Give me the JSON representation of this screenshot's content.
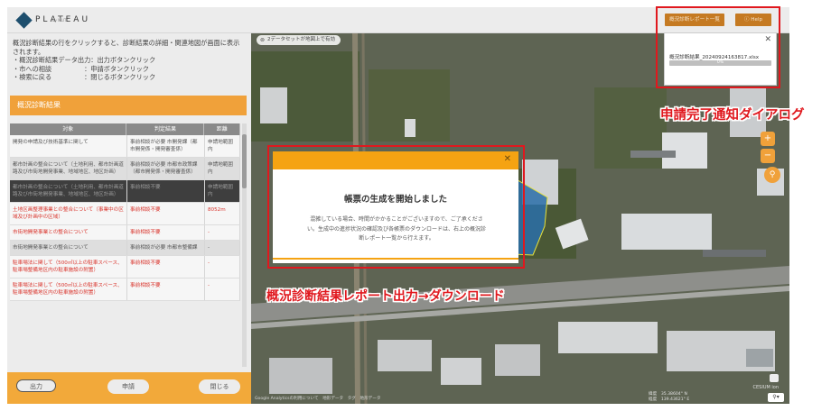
{
  "app": {
    "logo_text": "PLATEAU",
    "logo_sub": "by MLIT"
  },
  "panel": {
    "instructions": [
      "概況診断結果の行をクリックすると、診断結果の詳細・関連地図が画面に表示",
      "されます。",
      "・概況診断結果データ出力：出力ボタンクリック",
      "・市への相談　　　　　：申請ボタンクリック",
      "・検索に戻る　　　　　：閉じるボタンクリック"
    ],
    "section_title": "概況診断結果",
    "table": {
      "headers": [
        "対象",
        "判定結果",
        "距離"
      ],
      "rows": [
        {
          "style": "light",
          "cells": [
            "開発の申請及び技術基準に関して",
            "事前相談が必要 市開発課（都市開発係・開発審査係）",
            "申請地範囲内"
          ]
        },
        {
          "style": "mid",
          "cells": [
            "都市計画の整合について（土地利用、都市計画道路及び市街地開発事業、地域地区、地区計画）",
            "事前相談が必要 市都市政策課（都市開発係・開発審査係）",
            "申請地範囲内"
          ]
        },
        {
          "style": "dark",
          "cells": [
            "都市計画の整合について（土地利用、都市計画道路及び市街地開発事業、地域地区、地区計画）",
            "事前相談不要",
            "申請地範囲内"
          ]
        },
        {
          "style": "red",
          "cells": [
            "土地区画整理事業との整合について（事業中の区域及び計画中の区域）",
            "事前相談不要",
            "8052m"
          ]
        },
        {
          "style": "red",
          "cells": [
            "市街地開発事業との整合について",
            "事前相談不要",
            "-"
          ]
        },
        {
          "style": "mid",
          "cells": [
            "市街地開発事業との整合について",
            "事前相談が必要 市都市整備課",
            "-"
          ]
        },
        {
          "style": "red",
          "cells": [
            "駐車場法に関して（500㎡以上の駐車スペース、駐車場整備地区内の駐車施設の附置）",
            "事前相談不要",
            "-"
          ]
        },
        {
          "style": "red",
          "cells": [
            "駐車場法に関して（500㎡以上の駐車スペース、駐車場整備地区内の駐車施設の附置）",
            "事前相談不要",
            "-"
          ]
        }
      ]
    },
    "buttons": {
      "output": "出力",
      "apply": "申請",
      "close": "閉じる"
    }
  },
  "map": {
    "info_text": "2データセットが地図上で有効",
    "footer_links": "Google Analyticsの利用について　地形データ　タグ　地形データ",
    "coord_labels": [
      "緯度",
      "経度"
    ],
    "coord_values": [
      "35.38604° N",
      "139.43621° E"
    ],
    "cesium": "CESIUM ion"
  },
  "top_buttons": {
    "report_list": "概況診断レポート一覧",
    "help": "Help"
  },
  "notification": {
    "filename": "概況診断結果_20240924163817.xlsx",
    "progress_text": "0%",
    "progress": 0
  },
  "modal": {
    "title": "帳票の生成を開始しました",
    "body_lines": [
      "混雑している場合、時間がかかることがございますので、ご了承くださ",
      "い。生成中の進捗状況の確認及び各帳票のダウンロードは、右上の概況診",
      "断レポート一覧から行えます。"
    ]
  },
  "callouts": {
    "notification_label": "申請完了通知ダイアログ",
    "modal_label": "概況診断結果レポート出力→ダウンロード"
  },
  "colors": {
    "accent_orange": "#f0a13a",
    "callout_red": "#e0181e",
    "modal_header": "#f5a312"
  }
}
